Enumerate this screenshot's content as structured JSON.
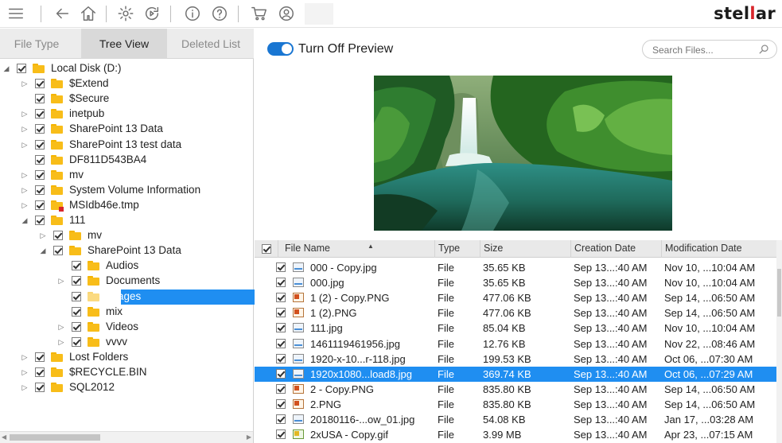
{
  "toolbar": {
    "brand_prefix": "stel",
    "brand_accent": "l",
    "brand_suffix": "ar",
    "icons": [
      "menu-icon",
      "back-arrow-icon",
      "home-icon",
      "settings-gear-icon",
      "update-icon",
      "info-icon",
      "help-icon",
      "cart-icon",
      "user-account-icon"
    ]
  },
  "left_tabs": [
    {
      "label": "File Type",
      "active": false
    },
    {
      "label": "Tree View",
      "active": true
    },
    {
      "label": "Deleted List",
      "active": false
    }
  ],
  "tree": [
    {
      "label": "Local Disk (D:)",
      "depth": 0,
      "expander": "open",
      "selected": false
    },
    {
      "label": "$Extend",
      "depth": 1,
      "expander": "closed",
      "selected": false
    },
    {
      "label": "$Secure",
      "depth": 1,
      "expander": "none",
      "selected": false
    },
    {
      "label": "inetpub",
      "depth": 1,
      "expander": "closed",
      "selected": false
    },
    {
      "label": "SharePoint 13 Data",
      "depth": 1,
      "expander": "closed",
      "selected": false
    },
    {
      "label": "SharePoint 13 test data",
      "depth": 1,
      "expander": "closed",
      "selected": false
    },
    {
      "label": "DF811D543BA4",
      "depth": 1,
      "expander": "none",
      "selected": false
    },
    {
      "label": "mv",
      "depth": 1,
      "expander": "closed",
      "selected": false
    },
    {
      "label": "System Volume Information",
      "depth": 1,
      "expander": "closed",
      "selected": false
    },
    {
      "label": "MSIdb46e.tmp",
      "depth": 1,
      "expander": "closed",
      "selected": false,
      "deleted_mark": true
    },
    {
      "label": "111",
      "depth": 1,
      "expander": "open",
      "selected": false
    },
    {
      "label": "mv",
      "depth": 2,
      "expander": "closed",
      "selected": false
    },
    {
      "label": "SharePoint 13 Data",
      "depth": 2,
      "expander": "open",
      "selected": false
    },
    {
      "label": "Audios",
      "depth": 3,
      "expander": "none",
      "selected": false
    },
    {
      "label": "Documents",
      "depth": 3,
      "expander": "closed",
      "selected": false
    },
    {
      "label": "Images",
      "depth": 3,
      "expander": "none",
      "selected": true
    },
    {
      "label": "mix",
      "depth": 3,
      "expander": "none",
      "selected": false
    },
    {
      "label": "Videos",
      "depth": 3,
      "expander": "closed",
      "selected": false
    },
    {
      "label": "vvvv",
      "depth": 3,
      "expander": "closed",
      "selected": false
    },
    {
      "label": "Lost Folders",
      "depth": 1,
      "expander": "closed",
      "selected": false
    },
    {
      "label": "$RECYCLE.BIN",
      "depth": 1,
      "expander": "closed",
      "selected": false
    },
    {
      "label": "SQL2012",
      "depth": 1,
      "expander": "closed",
      "selected": false
    }
  ],
  "preview": {
    "toggle_label": "Turn Off Preview",
    "toggle_on": true,
    "search_placeholder": "Search Files..."
  },
  "table": {
    "columns": [
      "File Name",
      "Type",
      "Size",
      "Creation Date",
      "Modification Date"
    ],
    "rows": [
      {
        "name": "000 - Copy.jpg",
        "type": "File",
        "size": "35.65 KB",
        "created": "Sep 13...:40 AM",
        "modified": "Nov 10, ...10:04 AM",
        "icon": "jpg",
        "selected": false
      },
      {
        "name": "000.jpg",
        "type": "File",
        "size": "35.65 KB",
        "created": "Sep 13...:40 AM",
        "modified": "Nov 10, ...10:04 AM",
        "icon": "jpg",
        "selected": false
      },
      {
        "name": "1 (2) - Copy.PNG",
        "type": "File",
        "size": "477.06 KB",
        "created": "Sep 13...:40 AM",
        "modified": "Sep 14, ...06:50 AM",
        "icon": "png",
        "selected": false
      },
      {
        "name": "1 (2).PNG",
        "type": "File",
        "size": "477.06 KB",
        "created": "Sep 13...:40 AM",
        "modified": "Sep 14, ...06:50 AM",
        "icon": "png",
        "selected": false
      },
      {
        "name": "111.jpg",
        "type": "File",
        "size": "85.04 KB",
        "created": "Sep 13...:40 AM",
        "modified": "Nov 10, ...10:04 AM",
        "icon": "jpg",
        "selected": false
      },
      {
        "name": "1461119461956.jpg",
        "type": "File",
        "size": "12.76 KB",
        "created": "Sep 13...:40 AM",
        "modified": "Nov 22, ...08:46 AM",
        "icon": "jpg",
        "selected": false
      },
      {
        "name": "1920-x-10...r-118.jpg",
        "type": "File",
        "size": "199.53 KB",
        "created": "Sep 13...:40 AM",
        "modified": "Oct 06, ...07:30 AM",
        "icon": "jpg",
        "selected": false
      },
      {
        "name": "1920x1080...load8.jpg",
        "type": "File",
        "size": "369.74 KB",
        "created": "Sep 13...:40 AM",
        "modified": "Oct 06, ...07:29 AM",
        "icon": "jpg",
        "selected": true
      },
      {
        "name": "2 - Copy.PNG",
        "type": "File",
        "size": "835.80 KB",
        "created": "Sep 13...:40 AM",
        "modified": "Sep 14, ...06:50 AM",
        "icon": "png",
        "selected": false
      },
      {
        "name": "2.PNG",
        "type": "File",
        "size": "835.80 KB",
        "created": "Sep 13...:40 AM",
        "modified": "Sep 14, ...06:50 AM",
        "icon": "png",
        "selected": false
      },
      {
        "name": "20180116-...ow_01.jpg",
        "type": "File",
        "size": "54.08 KB",
        "created": "Sep 13...:40 AM",
        "modified": "Jan 17, ...03:28 AM",
        "icon": "jpg",
        "selected": false
      },
      {
        "name": "2xUSA - Copy.gif",
        "type": "File",
        "size": "3.99 MB",
        "created": "Sep 13...:40 AM",
        "modified": "Apr 23, ...07:15 AM",
        "icon": "gif",
        "selected": false
      }
    ]
  },
  "colors": {
    "selection": "#1f8ef1",
    "brand_accent": "#d8262c",
    "toggle": "#1976d2",
    "folder": "#f8bd19"
  }
}
